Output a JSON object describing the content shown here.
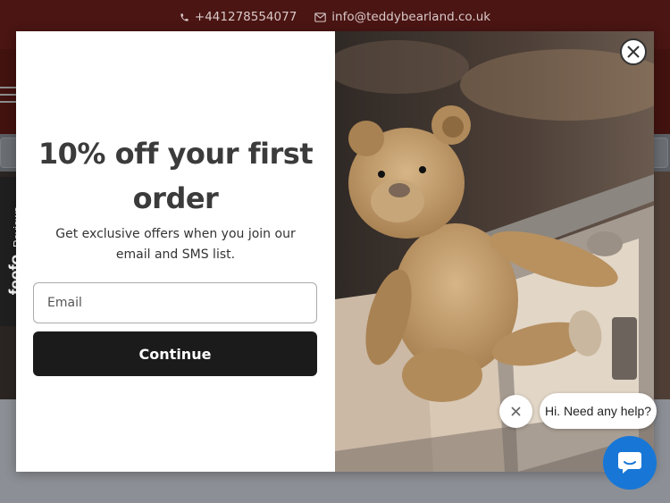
{
  "topbar": {
    "phone": "+441278554077",
    "email": "info@teddybearland.co.uk"
  },
  "popup": {
    "headline": "10% off your first order",
    "subtext": "Get exclusive offers when you join our email and SMS list.",
    "email_placeholder": "Email",
    "email_value": "",
    "continue_label": "Continue"
  },
  "feefo": {
    "logo_text": "feefo",
    "reviews_label": "Reviews"
  },
  "chat": {
    "greeting": "Hi. Need any help?"
  },
  "colors": {
    "topbar_bg": "#4a1513",
    "button_bg": "#1b1b1b",
    "chat_blue": "#1877d6",
    "feefo_yellow": "#f5c400"
  }
}
